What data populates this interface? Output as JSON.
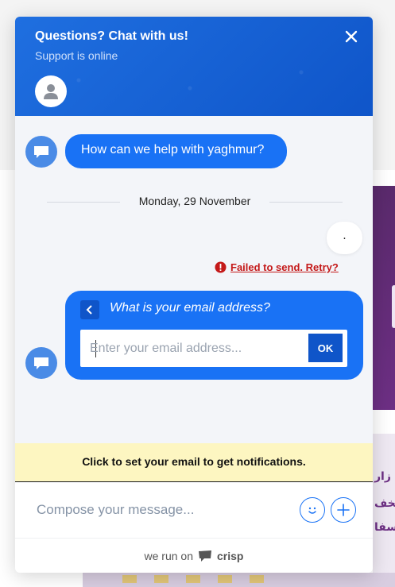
{
  "header": {
    "title": "Questions? Chat with us!",
    "status": "Support is online"
  },
  "messages": {
    "bot_greeting": "How can we help with yaghmur?",
    "date_separator": "Monday, 29 November",
    "user_message": ".",
    "failed_text": "Failed to send. Retry?"
  },
  "email_prompt": {
    "question": "What is your email address?",
    "placeholder": "Enter your email address...",
    "ok_label": "OK"
  },
  "notification_bar": {
    "text": "Click to set your email to get notifications."
  },
  "compose": {
    "placeholder": "Compose your message..."
  },
  "footer": {
    "prefix": "we run on",
    "brand": "crisp"
  },
  "colors": {
    "header_blue": "#1f6fe0",
    "bubble_blue": "#1972f5",
    "error_red": "#c41919",
    "notify_yellow": "#fdf6c1"
  },
  "icons": {
    "close": "close-icon",
    "avatar": "user-avatar-icon",
    "bot": "chat-bubble-icon",
    "back": "chevron-left-icon",
    "error": "error-icon",
    "emoji": "smiley-icon",
    "attach": "plus-icon",
    "brand": "crisp-logo-icon"
  }
}
